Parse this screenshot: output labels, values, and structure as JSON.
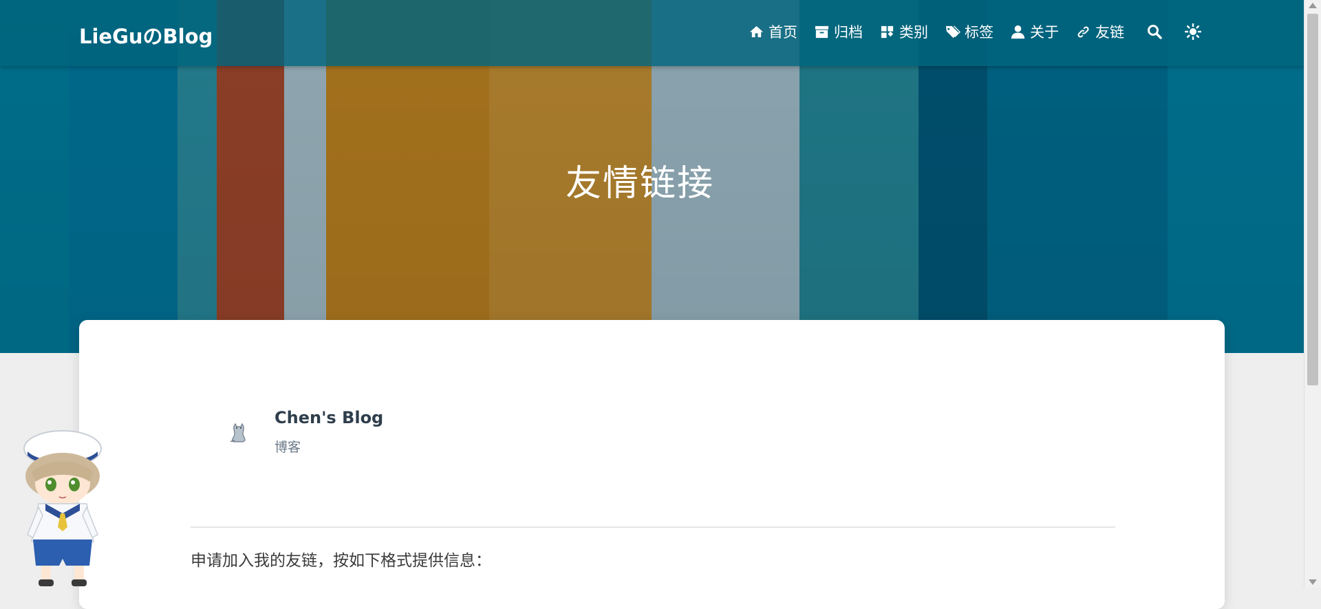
{
  "brand": "LieGuのBlog",
  "nav": {
    "items": [
      {
        "label": "首页",
        "icon": "home-icon"
      },
      {
        "label": "归档",
        "icon": "archive-icon"
      },
      {
        "label": "类别",
        "icon": "grid-icon"
      },
      {
        "label": "标签",
        "icon": "tags-icon"
      },
      {
        "label": "关于",
        "icon": "user-icon"
      },
      {
        "label": "友链",
        "icon": "link-icon"
      }
    ],
    "search_icon": "search-icon",
    "theme_icon": "sun-icon"
  },
  "page": {
    "title": "友情链接"
  },
  "friends": [
    {
      "name": "Chen's Blog",
      "description": "博客",
      "avatar_icon": "cat-avatar-icon"
    }
  ],
  "content": {
    "apply_text": "申请加入我的友链，按如下格式提供信息："
  },
  "colors": {
    "nav_bg": "#00647d",
    "banner_teal": "#006a87",
    "banner_rust": "#8b3e27",
    "banner_amber": "#a3711d",
    "banner_grey": "#8aa3ae"
  }
}
